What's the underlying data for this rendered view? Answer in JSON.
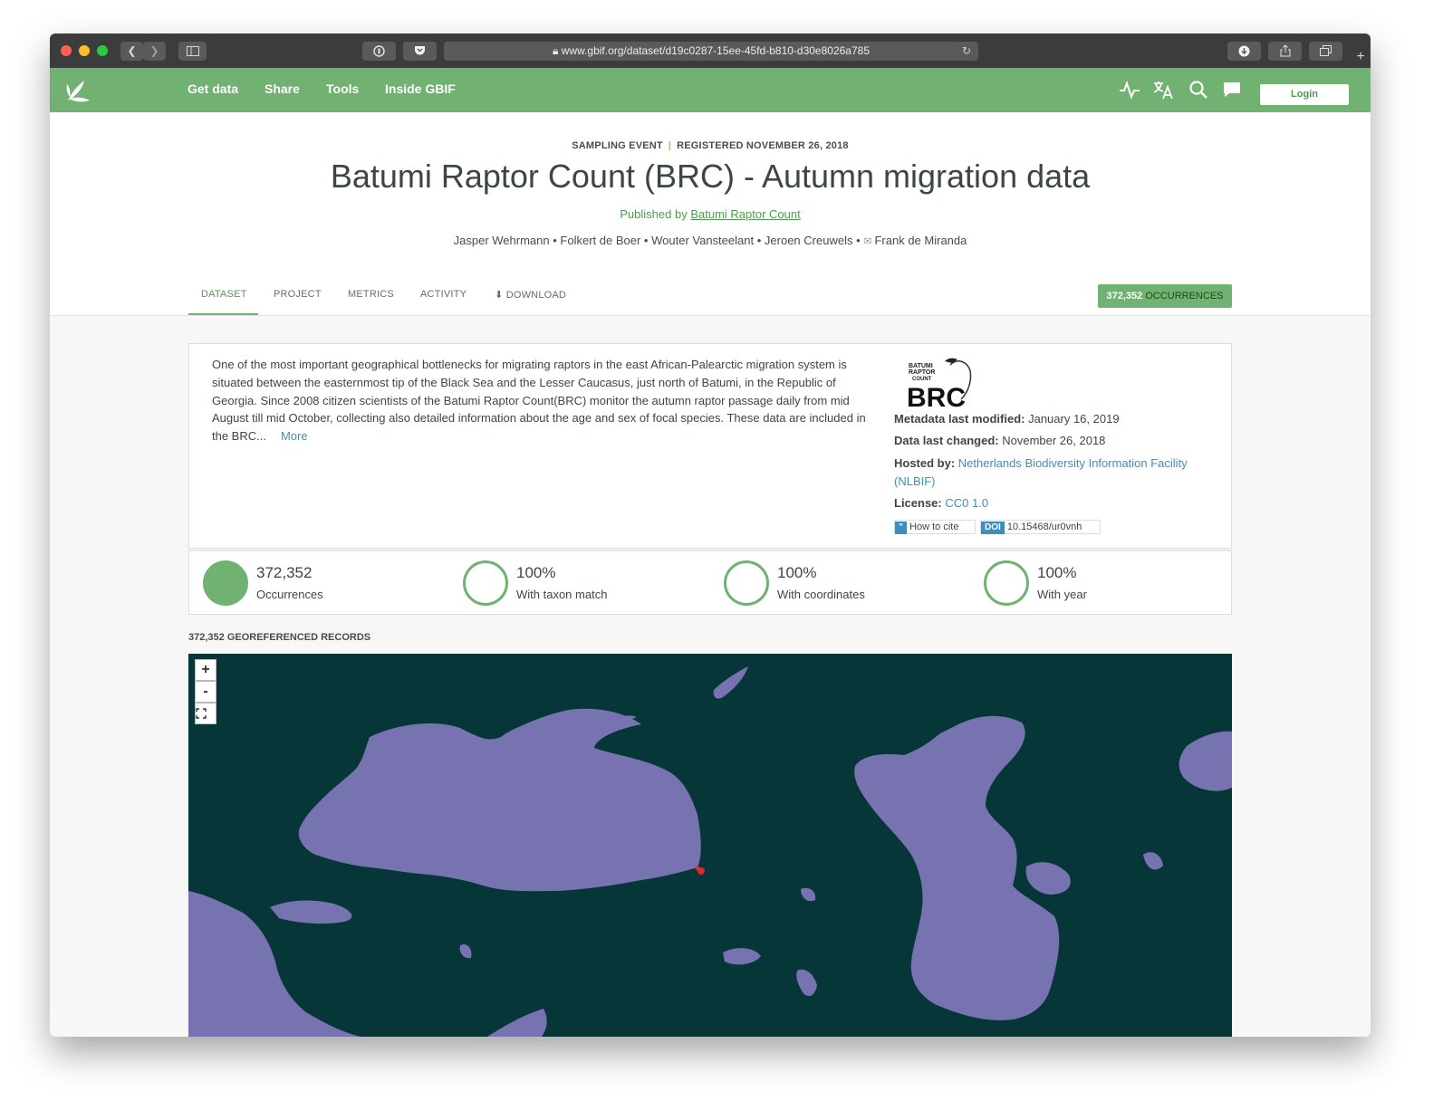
{
  "browser": {
    "url": "www.gbif.org/dataset/d19c0287-15ee-45fd-b810-d30e8026a785",
    "traffic_colors": [
      "#ff5f57",
      "#febc2e",
      "#28c840"
    ]
  },
  "nav": {
    "links": [
      "Get data",
      "Share",
      "Tools",
      "Inside GBIF"
    ],
    "icons": [
      "activity-icon",
      "translate-icon",
      "search-icon",
      "chat-icon"
    ],
    "login_label": "Login",
    "color": "#71b171"
  },
  "header": {
    "kicker_type": "SAMPLING EVENT",
    "kicker_registered": "REGISTERED NOVEMBER 26, 2018",
    "title": "Batumi Raptor Count (BRC) - Autumn migration data",
    "published_by_prefix": "Published by",
    "publisher": "Batumi Raptor Count",
    "authors": [
      "Jasper Wehrmann",
      "Folkert de Boer",
      "Wouter Vansteelant",
      "Jeroen Creuwels",
      "Frank de Miranda"
    ],
    "author_separator": "•"
  },
  "tabs": [
    {
      "label": "DATASET",
      "active": true
    },
    {
      "label": "PROJECT",
      "active": false
    },
    {
      "label": "METRICS",
      "active": false
    },
    {
      "label": "ACTIVITY",
      "active": false
    },
    {
      "label": "DOWNLOAD",
      "active": false,
      "icon": "download-icon"
    }
  ],
  "occurrence_badge": {
    "count": "372,352",
    "label": "OCCURRENCES"
  },
  "description": {
    "text": "One of the most important geographical bottlenecks for migrating raptors in the east African-Palearctic migration system is situated between the easternmost tip of the Black Sea and the Lesser Caucasus, just north of Batumi, in the Republic of Georgia. Since 2008 citizen scientists of the Batumi Raptor Count(BRC) monitor the autumn raptor passage daily from mid August till mid October, collecting also detailed information about the age and sex of focal species. These data are included in the BRC...",
    "more_label": "More"
  },
  "metadata": {
    "logo_text": [
      "BATUMI",
      "RAPTOR",
      "COUNT",
      "BRC"
    ],
    "metadata_modified_label": "Metadata last modified:",
    "metadata_modified": "January 16, 2019",
    "data_changed_label": "Data last changed:",
    "data_changed": "November 26, 2018",
    "hosted_by_label": "Hosted by:",
    "hosted_by": "Netherlands Biodiversity Information Facility (NLBIF)",
    "license_label": "License:",
    "license": "CC0 1.0",
    "cite_label": "How to cite",
    "cite_icon": "quote-icon",
    "doi_tag": "DOI",
    "doi": "10.15468/ur0vnh"
  },
  "stats": [
    {
      "value": "372,352",
      "label": "Occurrences",
      "filled": true
    },
    {
      "value": "100%",
      "label": "With taxon match",
      "filled": false
    },
    {
      "value": "100%",
      "label": "With coordinates",
      "filled": false
    },
    {
      "value": "100%",
      "label": "With year",
      "filled": false
    }
  ],
  "map": {
    "heading": "372,352 GEOREFERENCED RECORDS",
    "zoom_in": "+",
    "zoom_out": "-",
    "fullscreen_icon": "fullscreen-icon",
    "water_color": "#7772b0",
    "land_color": "#063638",
    "marker_color": "#d62d2d"
  }
}
